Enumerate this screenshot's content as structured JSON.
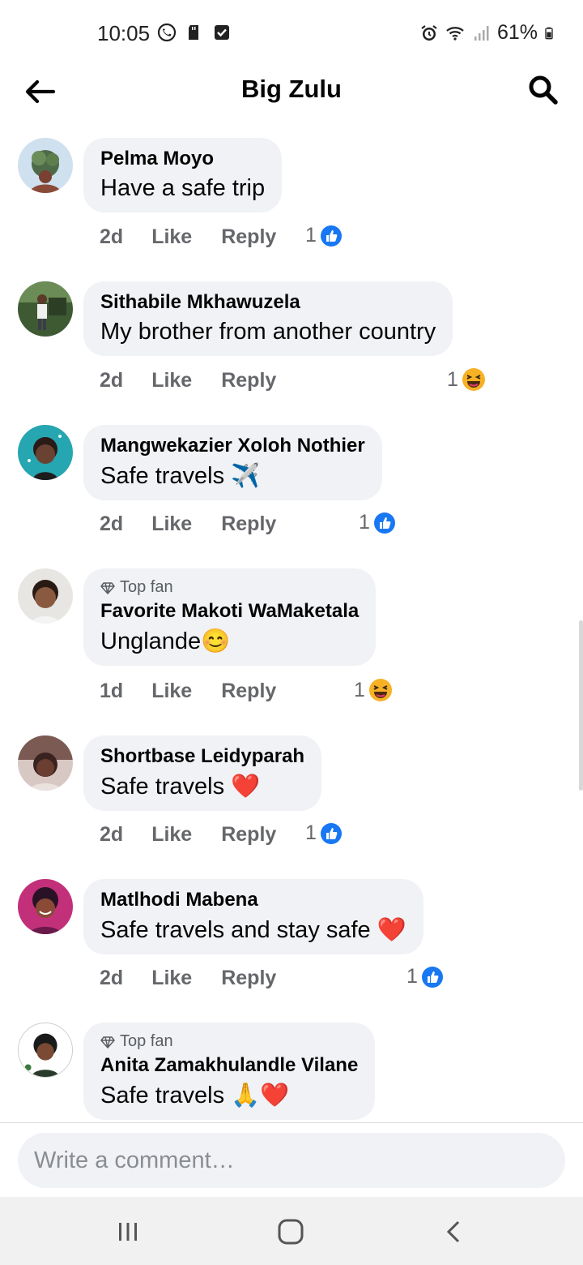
{
  "status_bar": {
    "time": "10:05",
    "battery": "61%"
  },
  "header": {
    "title": "Big Zulu"
  },
  "comments": [
    {
      "author": "Pelma Moyo",
      "text": "Have a safe trip",
      "time": "2d",
      "like": "Like",
      "reply": "Reply",
      "reaction_count": "1",
      "reaction": "like"
    },
    {
      "author": "Sithabile Mkhawuzela",
      "text": "My brother from another country",
      "time": "2d",
      "like": "Like",
      "reply": "Reply",
      "reaction_count": "1",
      "reaction": "haha"
    },
    {
      "author": "Mangwekazier Xoloh Nothier",
      "text": "Safe travels",
      "emoji": "✈️",
      "time": "2d",
      "like": "Like",
      "reply": "Reply",
      "reaction_count": "1",
      "reaction": "like"
    },
    {
      "badge": "Top fan",
      "author": "Favorite Makoti WaMaketala",
      "text": "Unglande",
      "emoji": "😊",
      "time": "1d",
      "like": "Like",
      "reply": "Reply",
      "reaction_count": "1",
      "reaction": "haha"
    },
    {
      "author": "Shortbase Leidyparah",
      "text": "Safe travels",
      "emoji": "❤️",
      "time": "2d",
      "like": "Like",
      "reply": "Reply",
      "reaction_count": "1",
      "reaction": "like"
    },
    {
      "author": "Matlhodi Mabena",
      "text": "Safe travels and stay safe",
      "emoji": "❤️",
      "time": "2d",
      "like": "Like",
      "reply": "Reply",
      "reaction_count": "1",
      "reaction": "like"
    },
    {
      "badge": "Top fan",
      "author": "Anita Zamakhulandle Vilane",
      "text": "Safe travels",
      "emoji": "🙏❤️",
      "time": "",
      "like": "",
      "reply": "",
      "reaction_count": "",
      "reaction": ""
    }
  ],
  "composer": {
    "placeholder": "Write a comment…"
  },
  "colors": {
    "bubble": "#f0f2f5",
    "like_blue": "#1877f2",
    "haha_yellow": "#f7b125",
    "meta_gray": "#65676b"
  }
}
